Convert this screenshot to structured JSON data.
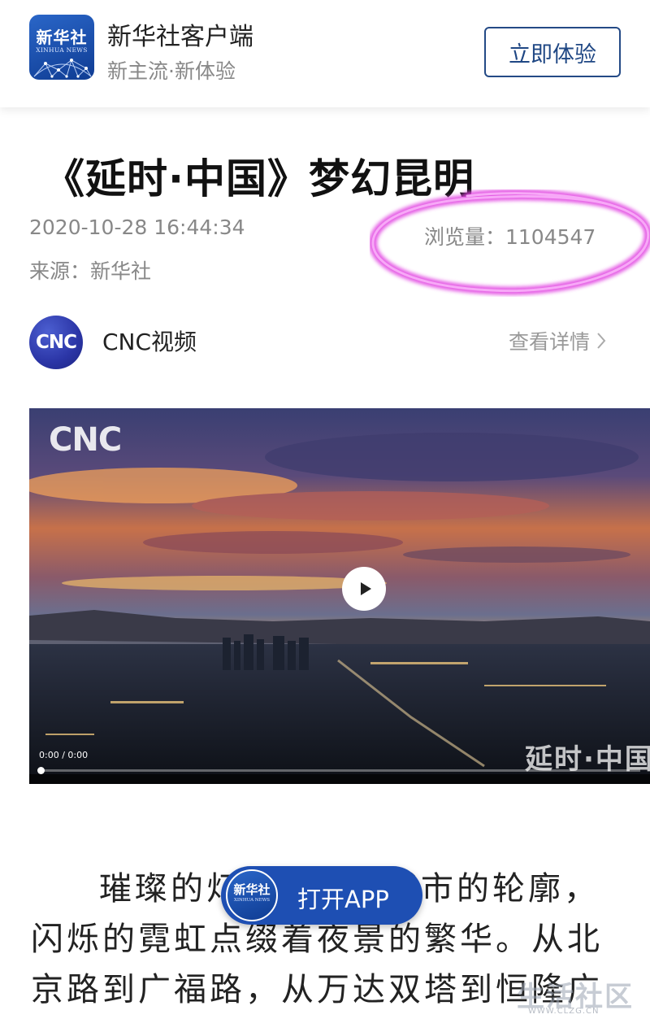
{
  "banner": {
    "logo_cn": "新华社",
    "logo_en": "XINHUA NEWS",
    "app_name": "新华社客户端",
    "slogan": "新主流·新体验",
    "try_button": "立即体验"
  },
  "article": {
    "title": "《延时·中国》梦幻昆明",
    "date": "2020-10-28 16:44:34",
    "views": "浏览量：1104547",
    "source": "来源：新华社"
  },
  "channel": {
    "avatar_text": "CNC",
    "name": "CNC视频",
    "details_link": "查看详情"
  },
  "video": {
    "watermark": "CNC",
    "time": "0:00 / 0:00",
    "progress": 0,
    "show_logo": "延时·中国"
  },
  "body": {
    "lines": [
      "璀璨的灯光勾勒出城市的轮廓，",
      "闪烁的霓虹点缀着夜景的繁华。从北",
      "京路到广福路，从万达双塔到恒隆广"
    ]
  },
  "open_app": {
    "label": "打开APP",
    "logo_cn": "新华社",
    "logo_en": "XINHUA NEWS"
  },
  "site_watermark": {
    "cn": "生活社区",
    "url": "WWW.CLZG.CN"
  },
  "colors": {
    "brand_blue": "#1e4fb3",
    "highlight_pink": "#e040e0",
    "meta_gray": "#888888"
  }
}
